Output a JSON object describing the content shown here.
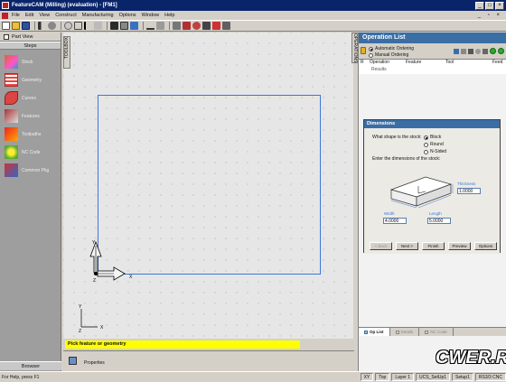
{
  "window": {
    "title": "FeatureCAM (Milling) (evaluation) - [FM1]"
  },
  "menu": [
    "File",
    "Edit",
    "View",
    "Construct",
    "Manufacturing",
    "Options",
    "Window",
    "Help"
  ],
  "left_panel": {
    "header": "Part View",
    "tab": "Steps",
    "steps": [
      "Stock",
      "Geometry",
      "Curves",
      "Features",
      "Toolpaths",
      "NC Code",
      "Common Pkg"
    ],
    "bottom_tab": "Browser"
  },
  "viewport_tab": "TOOLBOX",
  "axes": {
    "x_label": "X",
    "y_label": "Y",
    "z_label": "Z"
  },
  "prompt": "Pick feature or geometry",
  "properties_label": "Properties",
  "status": {
    "left": "For Help, press F1",
    "cells": [
      "XY",
      "Top",
      "Layer 1",
      "UCS_SetUp1",
      "Setup1",
      "RS3/3 CNC"
    ]
  },
  "op_list_tab": "OPERATIONS",
  "op_panel": {
    "title": "Operation List",
    "radio_auto": "Automatic Ordering",
    "radio_manual": "Manual Ordering",
    "columns": [
      "R",
      "Operation",
      "Feature",
      "Tool",
      "Feed"
    ],
    "results_label": "Results",
    "bottom_tabs": [
      "Op List",
      "Details",
      "NC Code"
    ]
  },
  "dialog": {
    "title": "Dimensions",
    "question": "What shape is the stock:",
    "shapes": [
      "Block",
      "Round",
      "N-Sided"
    ],
    "selected_shape": "Block",
    "enter_prompt": "Enter the dimensions of the stock:",
    "thickness_label": "Thickness",
    "thickness_value": "1.0000",
    "width_label": "Width",
    "width_value": "4.0000",
    "length_label": "Length",
    "length_value": "5.0000",
    "buttons": [
      "< Back",
      "Next >",
      "Finish",
      "Preview",
      "Options"
    ]
  },
  "watermark": "CWER.RU"
}
